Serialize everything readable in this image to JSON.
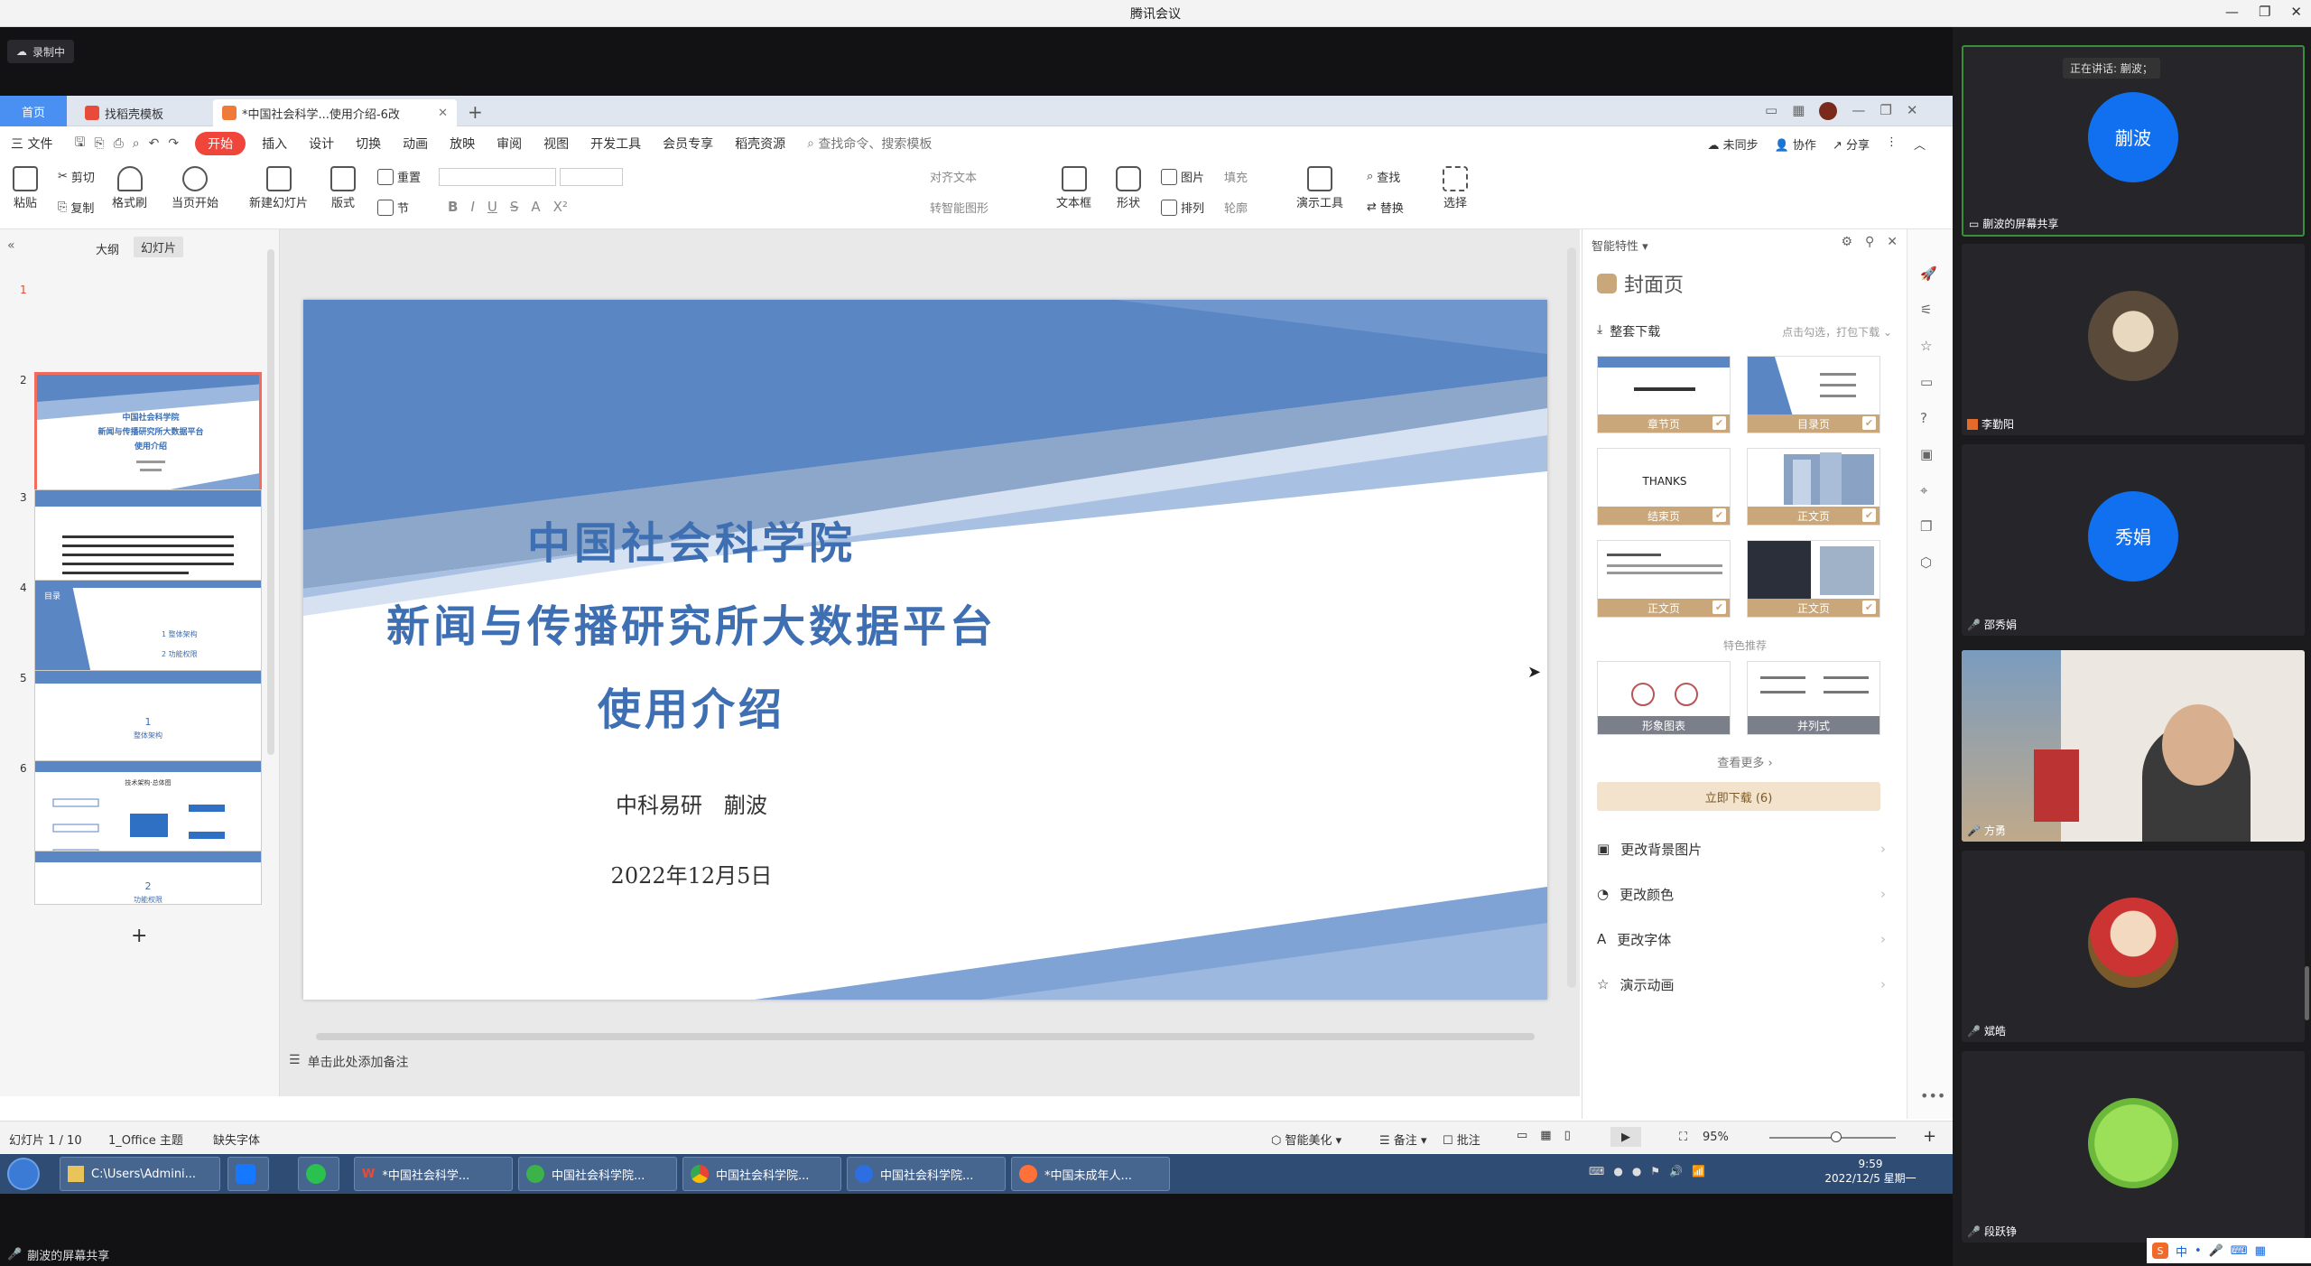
{
  "window": {
    "title": "腾讯会议"
  },
  "recording": {
    "label": "录制中"
  },
  "wps": {
    "tabs": [
      {
        "label": "首页"
      },
      {
        "label": "找稻壳模板"
      },
      {
        "label": "*中国社会科学...使用介绍-6改"
      }
    ],
    "menus": [
      "三 文件",
      "开始",
      "插入",
      "设计",
      "切换",
      "动画",
      "放映",
      "审阅",
      "视图",
      "开发工具",
      "会员专享",
      "稻壳资源"
    ],
    "search_placeholder": "查找命令、搜索模板",
    "sync": "未同步",
    "collab": "协作",
    "share": "分享",
    "ribbon": {
      "paste": "粘贴",
      "cut": "剪切",
      "copy": "复制",
      "painter": "格式刷",
      "play": "当页开始",
      "new_slide": "新建幻灯片",
      "layout": "版式",
      "section": "节",
      "reset": "重置",
      "text_box": "文本框",
      "shape": "形状",
      "picture": "图片",
      "arrange": "排列",
      "fill": "填充",
      "outline": "轮廓",
      "present_tools": "演示工具",
      "find": "查找",
      "replace": "替换",
      "select": "选择",
      "align_text": "对齐文本",
      "smartart": "转智能图形"
    },
    "left_tabs": {
      "outline": "大纲",
      "slides": "幻灯片"
    },
    "slides": [
      {
        "num": "1",
        "text": "中国社会科学院 新闻与传播研究所大数据平台 使用介绍"
      },
      {
        "num": "2",
        "text": ""
      },
      {
        "num": "3",
        "text": "目录",
        "items": [
          "1 整体架构",
          "2 功能权限"
        ]
      },
      {
        "num": "4",
        "text": "1 整体架构"
      },
      {
        "num": "5",
        "text": "技术架构·总体图"
      },
      {
        "num": "6",
        "text": "2 功能权限"
      }
    ],
    "slide_main": {
      "line1": "中国社会科学院",
      "line2": "新闻与传播研究所大数据平台",
      "line3": "使用介绍",
      "author": "中科易研　蒯波",
      "date": "2022年12月5日"
    },
    "notes": "单击此处添加备注",
    "smart": {
      "header": "智能特性",
      "title": "封面页",
      "bundle": "整套下载",
      "bundle_hint": "点击勾选，打包下载",
      "templates": [
        "章节页",
        "目录页",
        "结束页",
        "正文页",
        "正文页",
        "正文页"
      ],
      "featured": "特色推荐",
      "featured_items": [
        "形象图表",
        "并列式"
      ],
      "more": "查看更多",
      "download": "立即下载 (6)",
      "options": [
        "更改背景图片",
        "更改颜色",
        "更改字体",
        "演示动画"
      ]
    },
    "status": {
      "slide": "幻灯片 1 / 10",
      "theme": "1_Office 主题",
      "missing_font": "缺失字体",
      "beautify": "智能美化",
      "notes": "备注",
      "comment": "批注",
      "zoom": "95%"
    }
  },
  "taskbar": {
    "items": [
      "C:\\Users\\Admini...",
      "",
      "",
      "*中国社会科学...",
      "中国社会科学院...",
      "中国社会科学院...",
      "中国社会科学院...",
      "*中国未成年人..."
    ],
    "time": "9:59",
    "date": "2022/12/5 星期一"
  },
  "screen_share_label": "蒯波的屏幕共享",
  "participants": [
    {
      "name": "蒯波的屏幕共享",
      "avatar_text": "蒯波",
      "speaking": "正在讲话: 蒯波；",
      "color": "#1170f0"
    },
    {
      "name": "李勤阳",
      "avatar_text": "",
      "color": "#888"
    },
    {
      "name": "邵秀娟",
      "avatar_text": "秀娟",
      "color": "#1170f0"
    },
    {
      "name": "方勇",
      "avatar_text": "",
      "color": "#777"
    },
    {
      "name": "斌皓",
      "avatar_text": "",
      "color": "#777"
    },
    {
      "name": "段跃铮",
      "avatar_text": "",
      "color": "#777"
    }
  ],
  "ime": {
    "label": "中"
  }
}
